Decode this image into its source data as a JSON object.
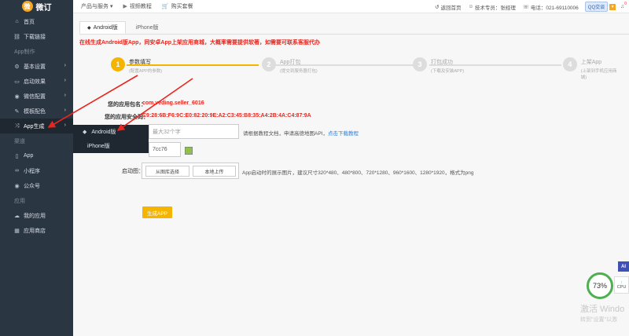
{
  "brand": {
    "logo_glyph": "微",
    "name": "微订"
  },
  "sidebar": {
    "items": [
      {
        "label": "首页",
        "icon": "home-icon",
        "glyph": "⌂"
      },
      {
        "label": "下载链接",
        "icon": "link-icon",
        "glyph": "⛓"
      }
    ],
    "section_app": "App制作",
    "app_items": [
      {
        "label": "基本设置",
        "icon": "gear-icon",
        "glyph": "⚙"
      },
      {
        "label": "启动效果",
        "icon": "monitor-icon",
        "glyph": "▭"
      },
      {
        "label": "微信配置",
        "icon": "wechat-icon",
        "glyph": "◉"
      },
      {
        "label": "模板配色",
        "icon": "palette-icon",
        "glyph": "✎"
      },
      {
        "label": "App生成",
        "icon": "shuffle-icon",
        "glyph": "⤨"
      }
    ],
    "section_channel": "渠道",
    "channel_items": [
      {
        "label": "App",
        "icon": "phone-icon",
        "glyph": "▯"
      },
      {
        "label": "小程序",
        "icon": "link-icon",
        "glyph": "∞"
      },
      {
        "label": "公众号",
        "icon": "wechat-icon",
        "glyph": "◉"
      }
    ],
    "section_apps": "应用",
    "apps_items": [
      {
        "label": "我的应用",
        "icon": "cloud-icon",
        "glyph": "☁"
      },
      {
        "label": "应用商店",
        "icon": "store-icon",
        "glyph": "▦"
      }
    ]
  },
  "flyout": {
    "items": [
      {
        "label": "Android版",
        "glyph": "◆"
      },
      {
        "label": "iPhone版",
        "glyph": ""
      }
    ]
  },
  "topbar": {
    "nav": [
      {
        "label": "产品与服务 ▾",
        "glyph": ""
      },
      {
        "label": "视频教程",
        "glyph": "▶"
      },
      {
        "label": "购买套餐",
        "glyph": "🛒"
      }
    ],
    "back_home": "返回首页",
    "support": "技术专员：张经理",
    "phone": "电话：021-69110006",
    "qq": "QQ交谈",
    "notification_count": "0"
  },
  "tabs": [
    {
      "label": "Android版",
      "glyph": "◆"
    },
    {
      "label": "iPhone版",
      "glyph": ""
    }
  ],
  "notice": "在线生成Android版App，同安卓App上架应用商城，大概率需要提供软著，如需要可联系客服代办",
  "steps": [
    {
      "num": "1",
      "title": "参数填写",
      "sub": "(配置APP的参数)"
    },
    {
      "num": "2",
      "title": "App打包",
      "sub": "(提交到服务器打包)"
    },
    {
      "num": "3",
      "title": "打包成功",
      "sub": "(下载及安装APP)"
    },
    {
      "num": "4",
      "title": "上架App",
      "sub": "(上架到手机应用商城)"
    }
  ],
  "form": {
    "package_label": "您的应用包名：",
    "package_value": "com.veding.seller_6016",
    "cert_label": "您的应用安全码：",
    "cert_value": "C9:28:6B:F6:9C:E0:82:20:9E:A2:C3:45:B8:35:A4:2B:4A:C4:87:9A",
    "name_placeholder": "最大32个字",
    "name_hint": "请根据教程文档，申请高德地图API，",
    "name_hint_link": "点击下载教程",
    "color_value": "7cc76",
    "splash_label": "启动图：",
    "btn_from_lib": "从图库选择",
    "btn_upload": "本地上传",
    "splash_hint": "App启动时的展示图片，建议尺寸320*480、480*800、720*1280、960*1600、1280*1920，格式为png",
    "generate": "生成APP"
  },
  "widgets": {
    "ai": "AI",
    "cpu_percent": "73%",
    "cpu_label": "CPU",
    "watermark_title": "激活 Windo",
    "watermark_sub": "转到\"设置\"以激"
  },
  "colors": {
    "sidebar": "#2b3643",
    "accent": "#f5b400",
    "red": "#e8261e"
  }
}
